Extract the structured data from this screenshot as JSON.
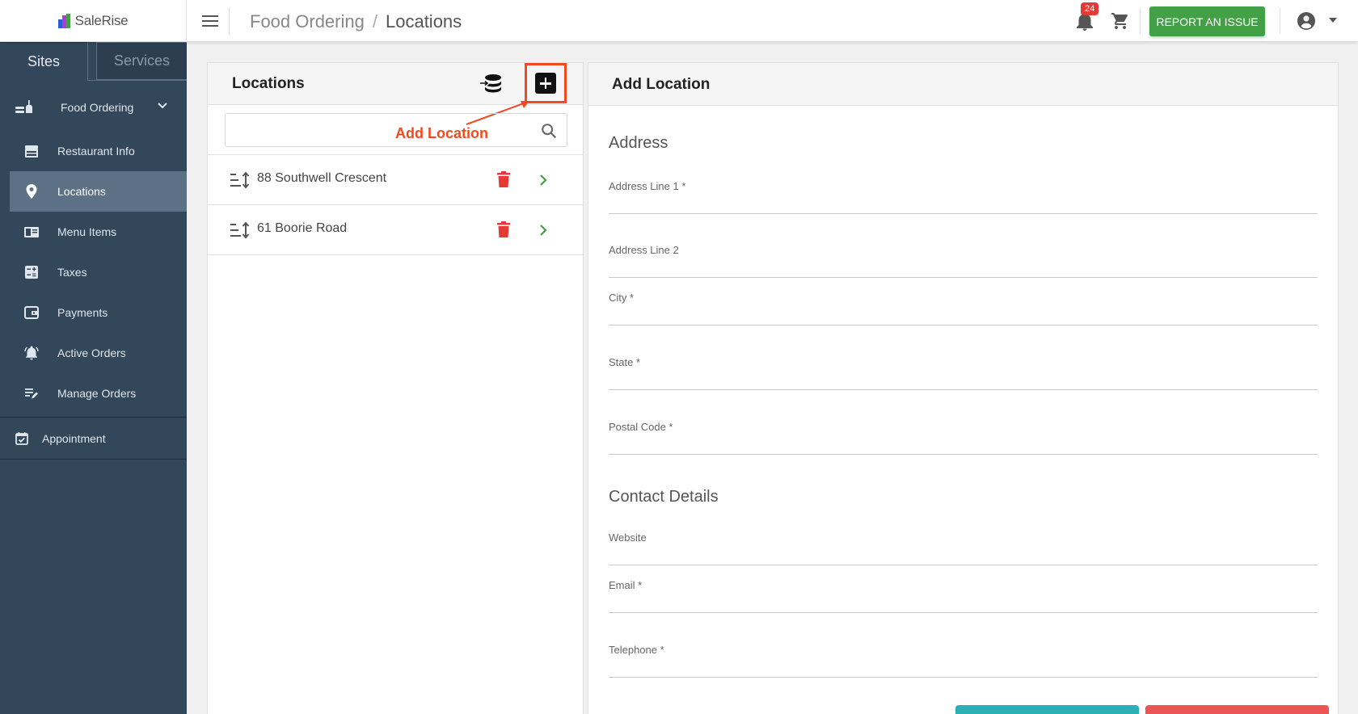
{
  "header": {
    "logo_text": "SaleRise",
    "breadcrumb": [
      "Food Ordering",
      "Locations"
    ],
    "breadcrumb_separator": "/",
    "notification_count": "24",
    "report_button_label": "REPORT AN ISSUE"
  },
  "sidebar": {
    "tabs": [
      "Sites",
      "Services"
    ],
    "group_label": "Food Ordering",
    "items": [
      {
        "label": "Restaurant Info",
        "icon": "storefront-icon"
      },
      {
        "label": "Locations",
        "icon": "map-pin-icon",
        "active": true
      },
      {
        "label": "Menu Items",
        "icon": "menu-book-icon"
      },
      {
        "label": "Taxes",
        "icon": "calculator-icon"
      },
      {
        "label": "Payments",
        "icon": "wallet-icon"
      },
      {
        "label": "Active Orders",
        "icon": "bell-ring-icon"
      },
      {
        "label": "Manage Orders",
        "icon": "edit-list-icon"
      }
    ],
    "appointment_label": "Appointment"
  },
  "locations_panel": {
    "title": "Locations",
    "annotation": "Add Location",
    "search": {
      "value": "",
      "placeholder": ""
    },
    "locations": [
      "88 Southwell Crescent",
      "61 Boorie Road"
    ]
  },
  "add_location": {
    "title": "Add Location",
    "address_section": "Address",
    "contact_section": "Contact Details",
    "fields": {
      "address_line_1": "Address Line 1 *",
      "address_line_2": "Address Line 2",
      "city": "City *",
      "state": "State *",
      "postal_code": "Postal Code *",
      "website": "Website",
      "email": "Email *",
      "telephone": "Telephone *"
    }
  },
  "colors": {
    "sidebar_bg": "#33475b",
    "sidebar_active": "#5c7186",
    "report_button": "#43a047",
    "annotation": "#f24a1e",
    "delete_icon": "#e53935",
    "chevron_green": "#43a047",
    "save_button": "#2bb0b5",
    "cancel_button": "#ea5455"
  }
}
